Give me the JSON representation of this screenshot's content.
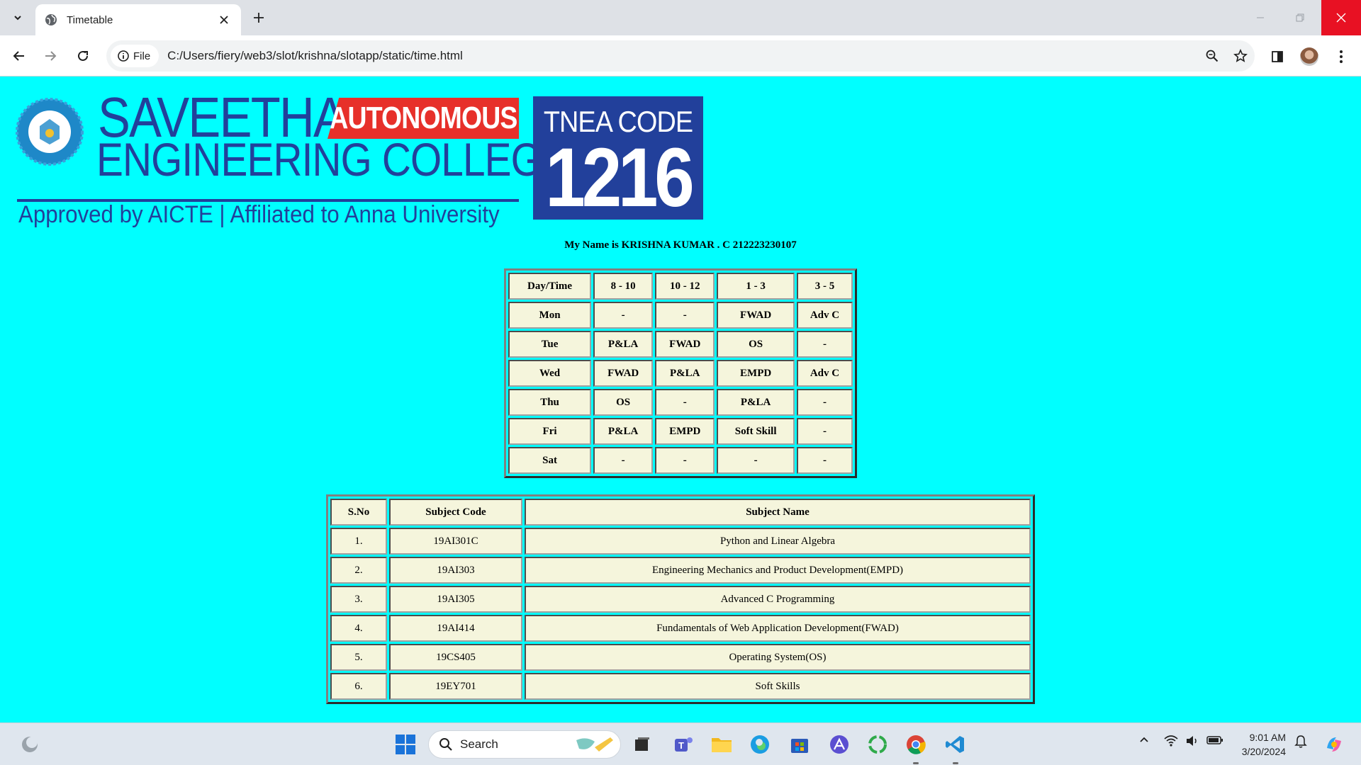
{
  "browser": {
    "tab_title": "Timetable",
    "site_chip_label": "File",
    "url": "C:/Users/fiery/web3/slot/krishna/slotapp/static/time.html"
  },
  "header": {
    "college_name_line1": "SAVEETHA",
    "autonomous_label": "AUTONOMOUS",
    "college_name_line2": "ENGINEERING COLLEGE",
    "approval_text": "Approved by AICTE  |  Affiliated to Anna University",
    "tnea_label": "TNEA CODE",
    "tnea_code": "1216"
  },
  "student_line": "My Name is KRISHNA KUMAR . C 212223230107",
  "timetable": {
    "headers": [
      "Day/Time",
      "8 - 10",
      "10 - 12",
      "1 - 3",
      "3 - 5"
    ],
    "rows": [
      [
        "Mon",
        "-",
        "-",
        "FWAD",
        "Adv C"
      ],
      [
        "Tue",
        "P&LA",
        "FWAD",
        "OS",
        "-"
      ],
      [
        "Wed",
        "FWAD",
        "P&LA",
        "EMPD",
        "Adv C"
      ],
      [
        "Thu",
        "OS",
        "-",
        "P&LA",
        "-"
      ],
      [
        "Fri",
        "P&LA",
        "EMPD",
        "Soft Skill",
        "-"
      ],
      [
        "Sat",
        "-",
        "-",
        "-",
        "-"
      ]
    ]
  },
  "subjects": {
    "headers": [
      "S.No",
      "Subject Code",
      "Subject Name"
    ],
    "rows": [
      [
        "1.",
        "19AI301C",
        "Python and Linear Algebra"
      ],
      [
        "2.",
        "19AI303",
        "Engineering Mechanics and Product Development(EMPD)"
      ],
      [
        "3.",
        "19AI305",
        "Advanced C Programming"
      ],
      [
        "4.",
        "19AI414",
        "Fundamentals of Web Application Development(FWAD)"
      ],
      [
        "5.",
        "19CS405",
        "Operating System(OS)"
      ],
      [
        "6.",
        "19EY701",
        "Soft Skills"
      ]
    ]
  },
  "taskbar": {
    "search_label": "Search",
    "time": "9:01 AM",
    "date": "3/20/2024"
  },
  "colors": {
    "page_background": "#00ffff",
    "cell_background": "#f5f5dc",
    "logo_blue": "#22409b",
    "logo_red": "#e7302a",
    "close_red": "#e81123"
  }
}
